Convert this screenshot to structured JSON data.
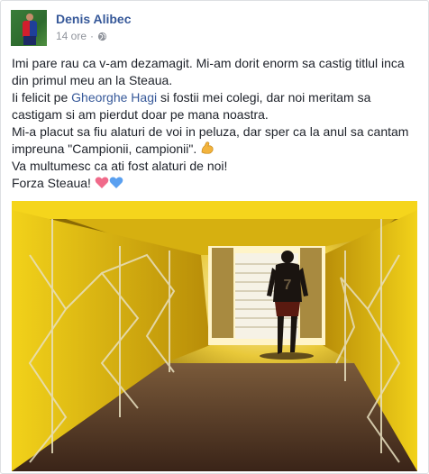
{
  "post": {
    "author": "Denis Alibec",
    "time": "14 ore",
    "separator": "·",
    "privacy_icon": "globe-icon",
    "lines": {
      "l1": "Imi pare rau ca v-am dezamagit. Mi-am dorit enorm sa castig titlul inca",
      "l2": "din primul meu an la Steaua.",
      "l3_pre": "Ii felicit pe ",
      "l3_link": "Gheorghe Hagi",
      "l3_post": " si fostii mei colegi, dar noi meritam sa",
      "l4": "castigam si am pierdut doar pe mana noastra.",
      "l5": "Mi-a placut sa fiu alaturi de voi in peluza, dar sper ca la anul sa cantam",
      "l6": "impreuna \"Campionii, campionii\". ",
      "l7": "Va multumesc ca ati fost alaturi de noi!",
      "l8": "Forza Steaua! "
    },
    "emojis": {
      "flexed_biceps": "flexed-biceps-icon",
      "red_heart": "heart-icon",
      "blue_heart": "heart-icon"
    },
    "photo_description_icon": "stadium-tunnel-photo"
  },
  "colors": {
    "link": "#365899",
    "meta": "#90949c",
    "text": "#1d2129",
    "tunnel_yellow": "#e8c20a",
    "heart_red": "#f06a8a",
    "heart_blue": "#5aa0f0"
  }
}
